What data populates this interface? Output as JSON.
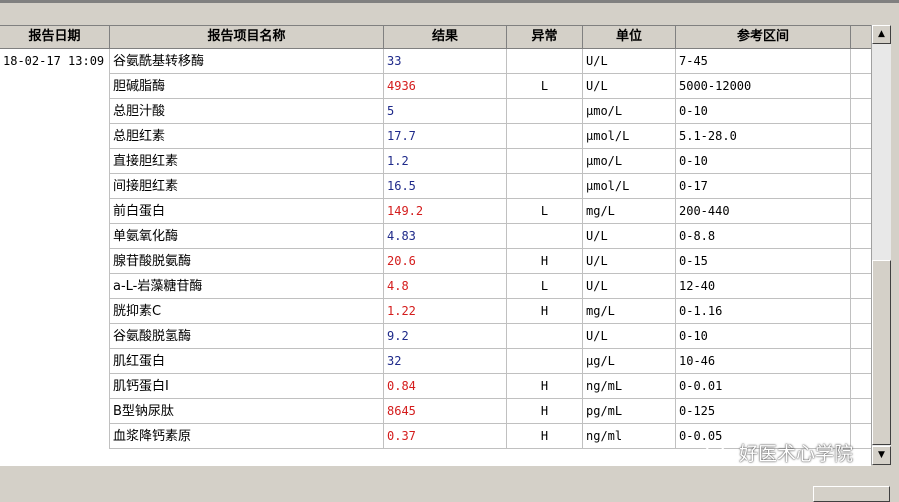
{
  "columns": {
    "date": "报告日期",
    "name": "报告项目名称",
    "result": "结果",
    "flag": "异常",
    "unit": "单位",
    "reference": "参考区间"
  },
  "report_date": "18-02-17 13:09",
  "rows": [
    {
      "name": "谷氨酰基转移酶",
      "result": "33",
      "flag": "",
      "unit": "U/L",
      "reference": "7-45",
      "abnormal": false
    },
    {
      "name": "胆碱脂酶",
      "result": "4936",
      "flag": "L",
      "unit": "U/L",
      "reference": "5000-12000",
      "abnormal": true
    },
    {
      "name": "总胆汁酸",
      "result": "5",
      "flag": "",
      "unit": "μmo/L",
      "reference": "0-10",
      "abnormal": false
    },
    {
      "name": "总胆红素",
      "result": "17.7",
      "flag": "",
      "unit": "μmol/L",
      "reference": "5.1-28.0",
      "abnormal": false
    },
    {
      "name": "直接胆红素",
      "result": "1.2",
      "flag": "",
      "unit": "μmo/L",
      "reference": "0-10",
      "abnormal": false
    },
    {
      "name": "间接胆红素",
      "result": "16.5",
      "flag": "",
      "unit": "μmol/L",
      "reference": "0-17",
      "abnormal": false
    },
    {
      "name": "前白蛋白",
      "result": "149.2",
      "flag": "L",
      "unit": "mg/L",
      "reference": "200-440",
      "abnormal": true
    },
    {
      "name": "单氨氧化酶",
      "result": "4.83",
      "flag": "",
      "unit": "U/L",
      "reference": "0-8.8",
      "abnormal": false
    },
    {
      "name": "腺苷酸脱氨酶",
      "result": "20.6",
      "flag": "H",
      "unit": "U/L",
      "reference": "0-15",
      "abnormal": true
    },
    {
      "name": "a-L-岩藻糖苷酶",
      "result": "4.8",
      "flag": "L",
      "unit": "U/L",
      "reference": "12-40",
      "abnormal": true
    },
    {
      "name": "胱抑素C",
      "result": "1.22",
      "flag": "H",
      "unit": "mg/L",
      "reference": "0-1.16",
      "abnormal": true
    },
    {
      "name": "谷氨酸脱氢酶",
      "result": "9.2",
      "flag": "",
      "unit": "U/L",
      "reference": "0-10",
      "abnormal": false
    },
    {
      "name": "肌红蛋白",
      "result": "32",
      "flag": "",
      "unit": "μg/L",
      "reference": "10-46",
      "abnormal": false
    },
    {
      "name": "肌钙蛋白I",
      "result": "0.84",
      "flag": "H",
      "unit": "ng/mL",
      "reference": "0-0.01",
      "abnormal": true
    },
    {
      "name": "B型钠尿肽",
      "result": "8645",
      "flag": "H",
      "unit": "pg/mL",
      "reference": "0-125",
      "abnormal": true
    },
    {
      "name": "血浆降钙素原",
      "result": "0.37",
      "flag": "H",
      "unit": "ng/ml",
      "reference": "0-0.05",
      "abnormal": true
    }
  ],
  "watermark": "好医术心学院",
  "icons": {
    "scroll_up": "scroll-up-arrow-icon",
    "scroll_down": "scroll-down-arrow-icon",
    "watermark": "wechat-icon"
  },
  "colors": {
    "abnormal_result": "#d41c1c",
    "normal_result": "#1f2a8a"
  }
}
